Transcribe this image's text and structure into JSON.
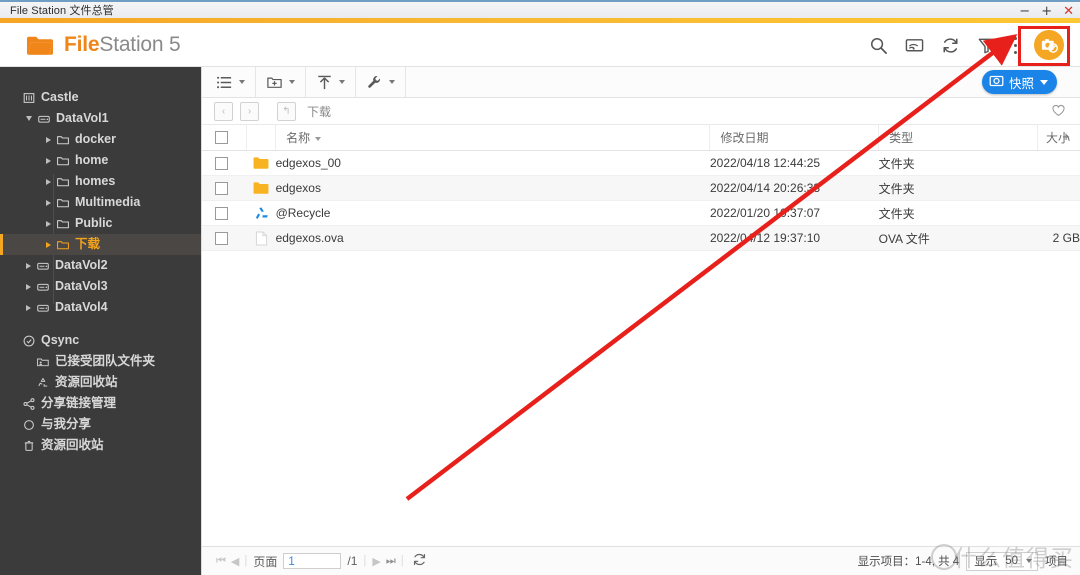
{
  "window": {
    "title": "File Station 文件总管",
    "controls": {
      "minimize": "−",
      "maximize": "+",
      "close": "✕"
    }
  },
  "header": {
    "brand_bold": "File",
    "brand_light": "Station 5",
    "icons": [
      "search-icon",
      "cast-icon",
      "refresh-icon",
      "filter-icon",
      "more-icon",
      "snapshot-round-icon"
    ],
    "accent_color": "#f5a623",
    "highlight_color": "#e8201b"
  },
  "snapshot_button": {
    "label": "快照"
  },
  "sidebar": {
    "items": [
      {
        "label": "Castle",
        "level": 0,
        "icon": "nas-icon",
        "arrow": "none",
        "selected": false
      },
      {
        "label": "DataVol1",
        "level": 1,
        "icon": "volume-icon",
        "arrow": "down",
        "selected": false
      },
      {
        "label": "docker",
        "level": 2,
        "icon": "folder-icon",
        "arrow": "right",
        "selected": false
      },
      {
        "label": "home",
        "level": 2,
        "icon": "folder-icon",
        "arrow": "right",
        "selected": false
      },
      {
        "label": "homes",
        "level": 2,
        "icon": "folder-icon",
        "arrow": "right",
        "selected": false
      },
      {
        "label": "Multimedia",
        "level": 2,
        "icon": "folder-icon",
        "arrow": "right",
        "selected": false
      },
      {
        "label": "Public",
        "level": 2,
        "icon": "folder-icon",
        "arrow": "right",
        "selected": false
      },
      {
        "label": "下载",
        "level": 2,
        "icon": "folder-icon",
        "arrow": "right",
        "selected": true
      },
      {
        "label": "DataVol2",
        "level": 1,
        "icon": "volume-icon",
        "arrow": "right",
        "selected": false
      },
      {
        "label": "DataVol3",
        "level": 1,
        "icon": "volume-icon",
        "arrow": "right",
        "selected": false
      },
      {
        "label": "DataVol4",
        "level": 1,
        "icon": "volume-icon",
        "arrow": "right",
        "selected": false
      }
    ],
    "items2": [
      {
        "label": "Qsync",
        "level": 0,
        "icon": "qsync-icon",
        "arrow": "none",
        "selected": false
      },
      {
        "label": "已接受团队文件夹",
        "level": 1,
        "icon": "team-icon",
        "arrow": "none",
        "selected": false
      },
      {
        "label": "资源回收站",
        "level": 1,
        "icon": "recycle-icon",
        "arrow": "none",
        "selected": false
      },
      {
        "label": "分享链接管理",
        "level": 0,
        "icon": "share-icon",
        "arrow": "none",
        "selected": false
      },
      {
        "label": "与我分享",
        "level": 0,
        "icon": "shared-icon",
        "arrow": "none",
        "selected": false
      },
      {
        "label": "资源回收站",
        "level": 0,
        "icon": "trash-icon",
        "arrow": "none",
        "selected": false
      }
    ]
  },
  "toolbar": {
    "groups": [
      {
        "icon": "list-view-icon",
        "name": "view-mode"
      },
      {
        "icon": "new-folder-icon",
        "name": "create"
      },
      {
        "icon": "upload-icon",
        "name": "upload"
      },
      {
        "icon": "tools-icon",
        "name": "tools"
      }
    ]
  },
  "breadcrumb": {
    "back": "‹",
    "forward": "›",
    "up": "↰",
    "path": "下载",
    "favorite": "heart-icon"
  },
  "table": {
    "columns": [
      "名称",
      "修改日期",
      "类型",
      "大小"
    ],
    "add_column": "+",
    "rows": [
      {
        "icon": "folder-icon",
        "name": "edgexos_00",
        "date": "2022/04/18 12:44:25",
        "type": "文件夹",
        "size": ""
      },
      {
        "icon": "folder-icon",
        "name": "edgexos",
        "date": "2022/04/14 20:26:33",
        "type": "文件夹",
        "size": ""
      },
      {
        "icon": "recycle-icon",
        "name": "@Recycle",
        "date": "2022/01/20 10:37:07",
        "type": "文件夹",
        "size": ""
      },
      {
        "icon": "file-icon",
        "name": "edgexos.ova",
        "date": "2022/04/12 19:37:10",
        "type": "OVA 文件",
        "size": "2 GB"
      }
    ]
  },
  "statusbar": {
    "first": "⏮",
    "prev": "◀",
    "page_label": "页面",
    "page_value": "1",
    "page_total": "/1",
    "next": "▶",
    "last": "⏭",
    "refresh": "refresh-icon",
    "items_text": "显示项目：1-4, 共 4",
    "show_label": "显示",
    "page_size": "50",
    "items_label": "项目"
  },
  "watermark": {
    "text": "什么值得买"
  }
}
